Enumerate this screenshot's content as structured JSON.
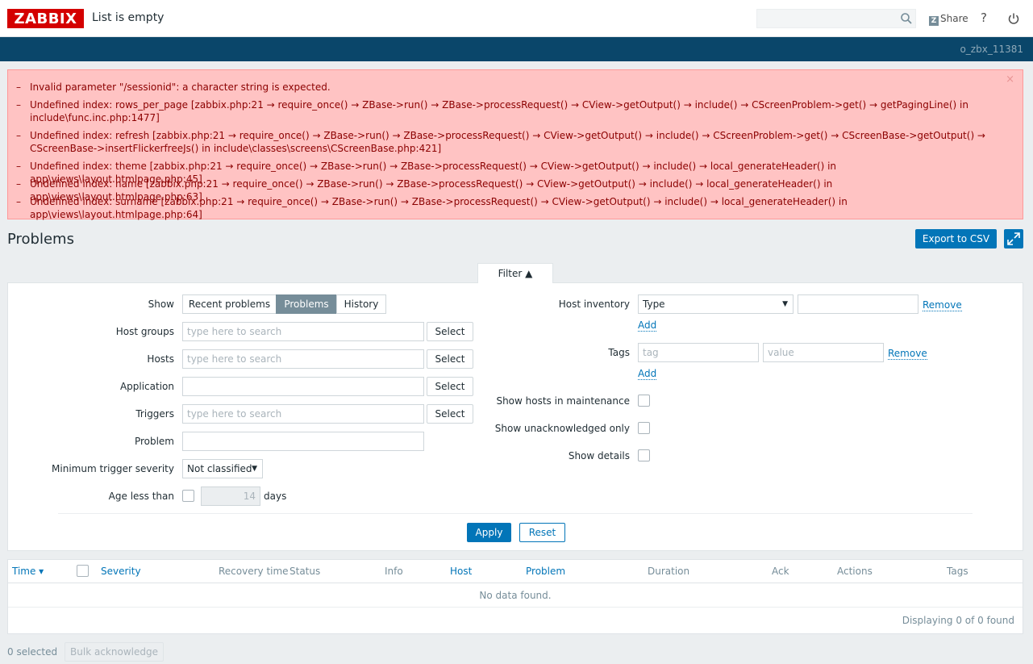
{
  "header": {
    "logo": "ZABBIX",
    "heading": "List is empty",
    "search_placeholder": "",
    "share_label": "Share",
    "help_label": "?",
    "username": "o_zbx_11381"
  },
  "errors": [
    "Invalid parameter \"/sessionid\": a character string is expected.",
    "Undefined index: rows_per_page [zabbix.php:21 → require_once() → ZBase->run() → ZBase->processRequest() → CView->getOutput() → include() → CScreenProblem->get() → getPagingLine() in include\\func.inc.php:1477]",
    "Undefined index: refresh [zabbix.php:21 → require_once() → ZBase->run() → ZBase->processRequest() → CView->getOutput() → include() → CScreenProblem->get() → CScreenBase->getOutput() → CScreenBase->insertFlickerfreeJs() in include\\classes\\screens\\CScreenBase.php:421]",
    "Undefined index: theme [zabbix.php:21 → require_once() → ZBase->run() → ZBase->processRequest() → CView->getOutput() → include() → local_generateHeader() in app\\views\\layout.htmlpage.php:45]",
    "Undefined index: name [zabbix.php:21 → require_once() → ZBase->run() → ZBase->processRequest() → CView->getOutput() → include() → local_generateHeader() in app\\views\\layout.htmlpage.php:63]",
    "Undefined index: surname [zabbix.php:21 → require_once() → ZBase->run() → ZBase->processRequest() → CView->getOutput() → include() → local_generateHeader() in app\\views\\layout.htmlpage.php:64]"
  ],
  "page": {
    "title": "Problems",
    "export_label": "Export to CSV"
  },
  "filter": {
    "tab_label": "Filter ▲",
    "show_label": "Show",
    "show_options": [
      "Recent problems",
      "Problems",
      "History"
    ],
    "host_groups_label": "Host groups",
    "hosts_label": "Hosts",
    "application_label": "Application",
    "triggers_label": "Triggers",
    "problem_label": "Problem",
    "min_severity_label": "Minimum trigger severity",
    "min_severity_value": "Not classified",
    "age_label": "Age less than",
    "age_value": "14",
    "age_unit": "days",
    "search_placeholder": "type here to search",
    "select_label": "Select",
    "host_inventory_label": "Host inventory",
    "host_inventory_type": "Type",
    "remove_label": "Remove",
    "add_label": "Add",
    "tags_label": "Tags",
    "tag_placeholder": "tag",
    "value_placeholder": "value",
    "maintenance_label": "Show hosts in maintenance",
    "unack_label": "Show unacknowledged only",
    "details_label": "Show details",
    "apply_label": "Apply",
    "reset_label": "Reset"
  },
  "table": {
    "columns": [
      "Time ▾",
      "Severity",
      "Recovery time",
      "Status",
      "Info",
      "Host",
      "Problem",
      "Duration",
      "Ack",
      "Actions",
      "Tags"
    ],
    "empty_text": "No data found.",
    "paging_text": "Displaying 0 of 0 found"
  },
  "footer": {
    "selected_text": "0 selected",
    "bulk_label": "Bulk acknowledge"
  }
}
